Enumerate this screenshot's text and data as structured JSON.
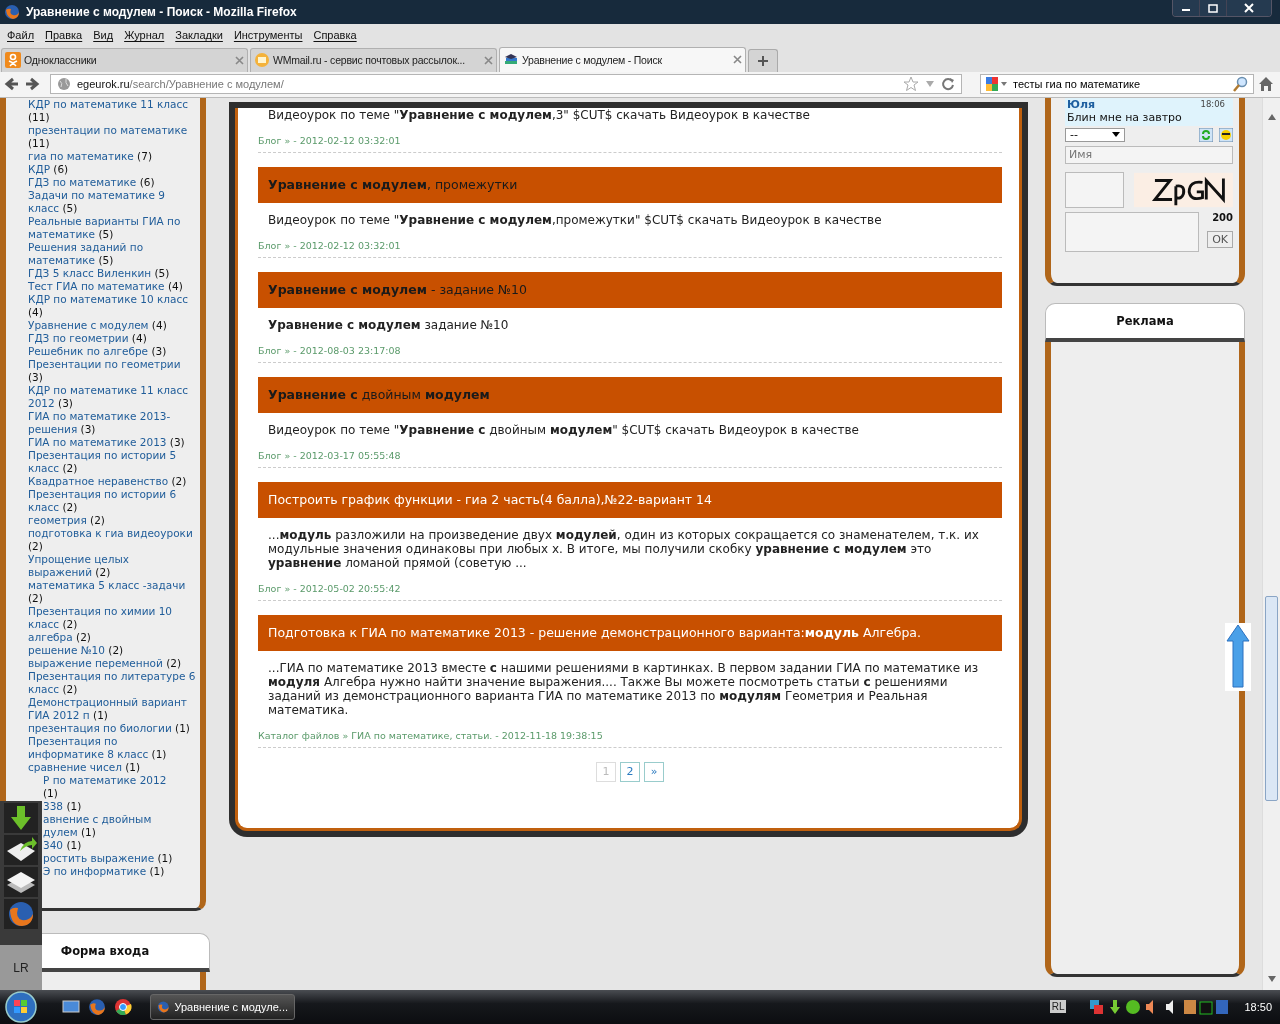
{
  "window": {
    "title": "Уравнение с модулем - Поиск - Mozilla Firefox"
  },
  "menu": [
    "Файл",
    "Правка",
    "Вид",
    "Журнал",
    "Закладки",
    "Инструменты",
    "Справка"
  ],
  "tabs": [
    {
      "label": "Одноклассники",
      "selected": false,
      "kind": "ok"
    },
    {
      "label": "WMmail.ru - сервис почтовых рассылок...",
      "selected": false,
      "kind": "mail"
    },
    {
      "label": "Уравнение с модулем - Поиск",
      "selected": true,
      "kind": "site"
    }
  ],
  "address": {
    "host": "egeurok.ru",
    "path": "/search/Уравнение с модулем/"
  },
  "search": {
    "value": "тесты гиа по математике"
  },
  "tags": [
    {
      "text": "КДР по математике 11 класс",
      "count": "(11)"
    },
    {
      "text": "презентации по математике",
      "count": "(11)"
    },
    {
      "text": "гиа по математике",
      "count": "(7)"
    },
    {
      "text": "КДР",
      "count": "(6)"
    },
    {
      "text": "ГДЗ по математике",
      "count": "(6)"
    },
    {
      "text": "Задачи по математике 9 класс",
      "count": "(5)"
    },
    {
      "text": "Реальные варианты ГИА по математике",
      "count": "(5)"
    },
    {
      "text": "Решения заданий по математике",
      "count": "(5)"
    },
    {
      "text": "ГДЗ 5 класс Виленкин",
      "count": "(5)"
    },
    {
      "text": "Тест ГИА по математике",
      "count": "(4)"
    },
    {
      "text": "КДР по математике 10 класс",
      "count": "(4)"
    },
    {
      "text": "Уравнение с модулем",
      "count": "(4)"
    },
    {
      "text": "ГДЗ по геометрии",
      "count": "(4)"
    },
    {
      "text": "Решебник по алгебре",
      "count": "(3)"
    },
    {
      "text": "Презентации по геометрии",
      "count": "(3)"
    },
    {
      "text": "КДР по математике 11 класс 2012",
      "count": "(3)"
    },
    {
      "text": "ГИА по математике 2013-решения",
      "count": "(3)"
    },
    {
      "text": "ГИА по математике 2013",
      "count": "(3)"
    },
    {
      "text": "Презентация по истории 5 класс",
      "count": "(2)"
    },
    {
      "text": "Квадратное неравенство",
      "count": "(2)"
    },
    {
      "text": "Презентация по истории 6 класс",
      "count": "(2)"
    },
    {
      "text": "геометрия",
      "count": "(2)"
    },
    {
      "text": "подготовка к гиа видеоуроки",
      "count": "(2)"
    },
    {
      "text": "Упрощение целых выражений",
      "count": "(2)"
    },
    {
      "text": "математика 5 класс -задачи",
      "count": "(2)"
    },
    {
      "text": "Презентация по химии 10 класс",
      "count": "(2)"
    },
    {
      "text": "алгебра",
      "count": "(2)"
    },
    {
      "text": "решение №10",
      "count": "(2)"
    },
    {
      "text": "выражение переменной",
      "count": "(2)"
    },
    {
      "text": "Презентация по литературе 6 класс",
      "count": "(2)"
    },
    {
      "text": "Демонстрационный вариант ГИА 2012 п",
      "count": "(1)"
    },
    {
      "text": "презентация по биологии",
      "count": "(1)"
    },
    {
      "text": "Презентация по информатике 8 класс",
      "count": "(1)"
    },
    {
      "text": "сравнение чисел",
      "count": "(1)"
    },
    {
      "text": "Р по математике 2012",
      "count": "(1)",
      "covered": true
    },
    {
      "text": "338",
      "count": "(1)",
      "covered": true
    },
    {
      "text": "авнение с двойным дулем",
      "count": "(1)",
      "covered": true
    },
    {
      "text": "340",
      "count": "(1)",
      "covered": true
    },
    {
      "text": "ростить выражение",
      "count": "(1)",
      "covered": true
    },
    {
      "text": "Э по информатике",
      "count": "(1)",
      "covered": true
    }
  ],
  "login_panel": {
    "title": "Форма входа"
  },
  "results": [
    {
      "snippet": "Видеоурок по теме \"**Уравнение с модулем**,3\" $CUT$ скачать Видеоурок в качестве",
      "meta": "Блог » - 2012-02-12 03:32:01"
    },
    {
      "title": "**Уравнение с модулем**, промежутки",
      "color": "#1a1a1a",
      "snippet": "Видеоурок по теме \"**Уравнение с модулем**,промежутки\" $CUT$ скачать Видеоурок в качестве",
      "meta": "Блог » - 2012-02-12 03:32:01"
    },
    {
      "title": "**Уравнение с модулем** - задание №10",
      "color": "#1a1a1a",
      "snippet": "**Уравнение с модулем** задание №10",
      "meta": "Блог » - 2012-08-03 23:17:08"
    },
    {
      "title": "**Уравнение с** двойным **модулем**",
      "color": "#1a1a1a",
      "snippet": "Видеоурок по теме \"**Уравнение с** двойным **модулем**\" $CUT$ скачать Видеоурок в качестве",
      "meta": "Блог » - 2012-03-17 05:55:48"
    },
    {
      "title": "Построить график функции - гиа 2 часть(4 балла),№22-вариант 14",
      "color": "#ffffff",
      "snippet": "...**модуль** разложили на произведение двух **модулей**, один из которых сокращается со знаменателем, т.к. их модульные значения одинаковы при любых x. В итоге, мы получили скобку **уравнение с модулем** это **уравнение** ломаной прямой (советую ...",
      "meta": "Блог » - 2012-05-02 20:55:42"
    },
    {
      "title": "Подготовка к ГИА по математике 2013 - решение демонстрационного варианта:**модуль** Алгебра.",
      "color": "#ffffff",
      "snippet": "...ГИА по математике 2013 вместе **с** нашими решениями в картинках. В первом задании ГИА по математике из **модуля** Алгебра нужно найти значение выражения.... Также Вы можете посмотреть статьи **с** решениями заданий из демонстрационного варианта ГИА по математике 2013 по **модулям** Геометрия и Реальная математика.",
      "meta": "Каталог файлов » ГИА по математике, статьи. - 2012-11-18 19:38:15"
    }
  ],
  "pages": [
    {
      "label": "1",
      "selected": true
    },
    {
      "label": "2",
      "selected": false
    },
    {
      "label": "»",
      "selected": false
    }
  ],
  "chat": {
    "author": "Юля",
    "time": "18:06",
    "message": "Блин мне на завтро",
    "select": "--",
    "name_placeholder": "Имя",
    "counter": "200",
    "ok": "OK"
  },
  "ad_panel": {
    "title": "Реклама"
  },
  "dock": {
    "label": "LR"
  },
  "taskbar": {
    "task": "Уравнение с модуле...",
    "tray_label": "RL",
    "clock": "18:50"
  }
}
